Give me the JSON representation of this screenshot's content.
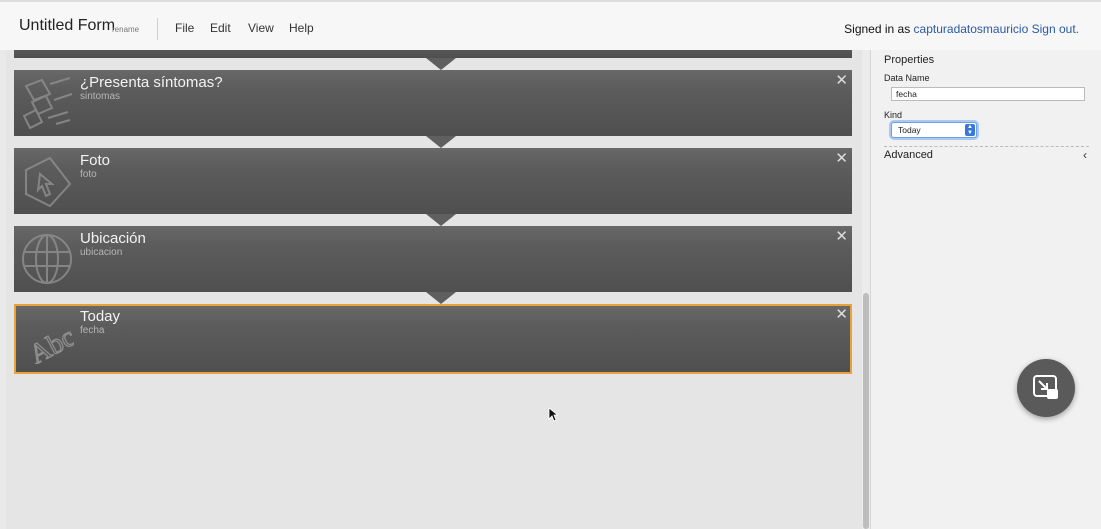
{
  "app": {
    "title": "Untitled Form",
    "rename_label": "rename"
  },
  "menu": [
    "File",
    "Edit",
    "View",
    "Help"
  ],
  "account": {
    "prefix": "Signed in as ",
    "user": "capturadatosmauricio",
    "signout": "Sign out."
  },
  "fields": [
    {
      "title": "¿Presenta síntomas?",
      "name": "sintomas",
      "icon": "checklist-icon",
      "selected": false
    },
    {
      "title": "Foto",
      "name": "foto",
      "icon": "photo-cursor-icon",
      "selected": false
    },
    {
      "title": "Ubicación",
      "name": "ubicacion",
      "icon": "globe-icon",
      "selected": false
    },
    {
      "title": "Today",
      "name": "fecha",
      "icon": "text-abc-icon",
      "selected": true
    }
  ],
  "close_glyph": "✕",
  "properties": {
    "heading": "Properties",
    "data_name_label": "Data Name",
    "data_name_value": "fecha",
    "kind_label": "Kind",
    "kind_value": "Today",
    "advanced_label": "Advanced",
    "advanced_chevron": "‹"
  },
  "colors": {
    "accent_selected": "#e8a23a",
    "link": "#2a5aa6",
    "field_bg": "#5a5a5a"
  }
}
